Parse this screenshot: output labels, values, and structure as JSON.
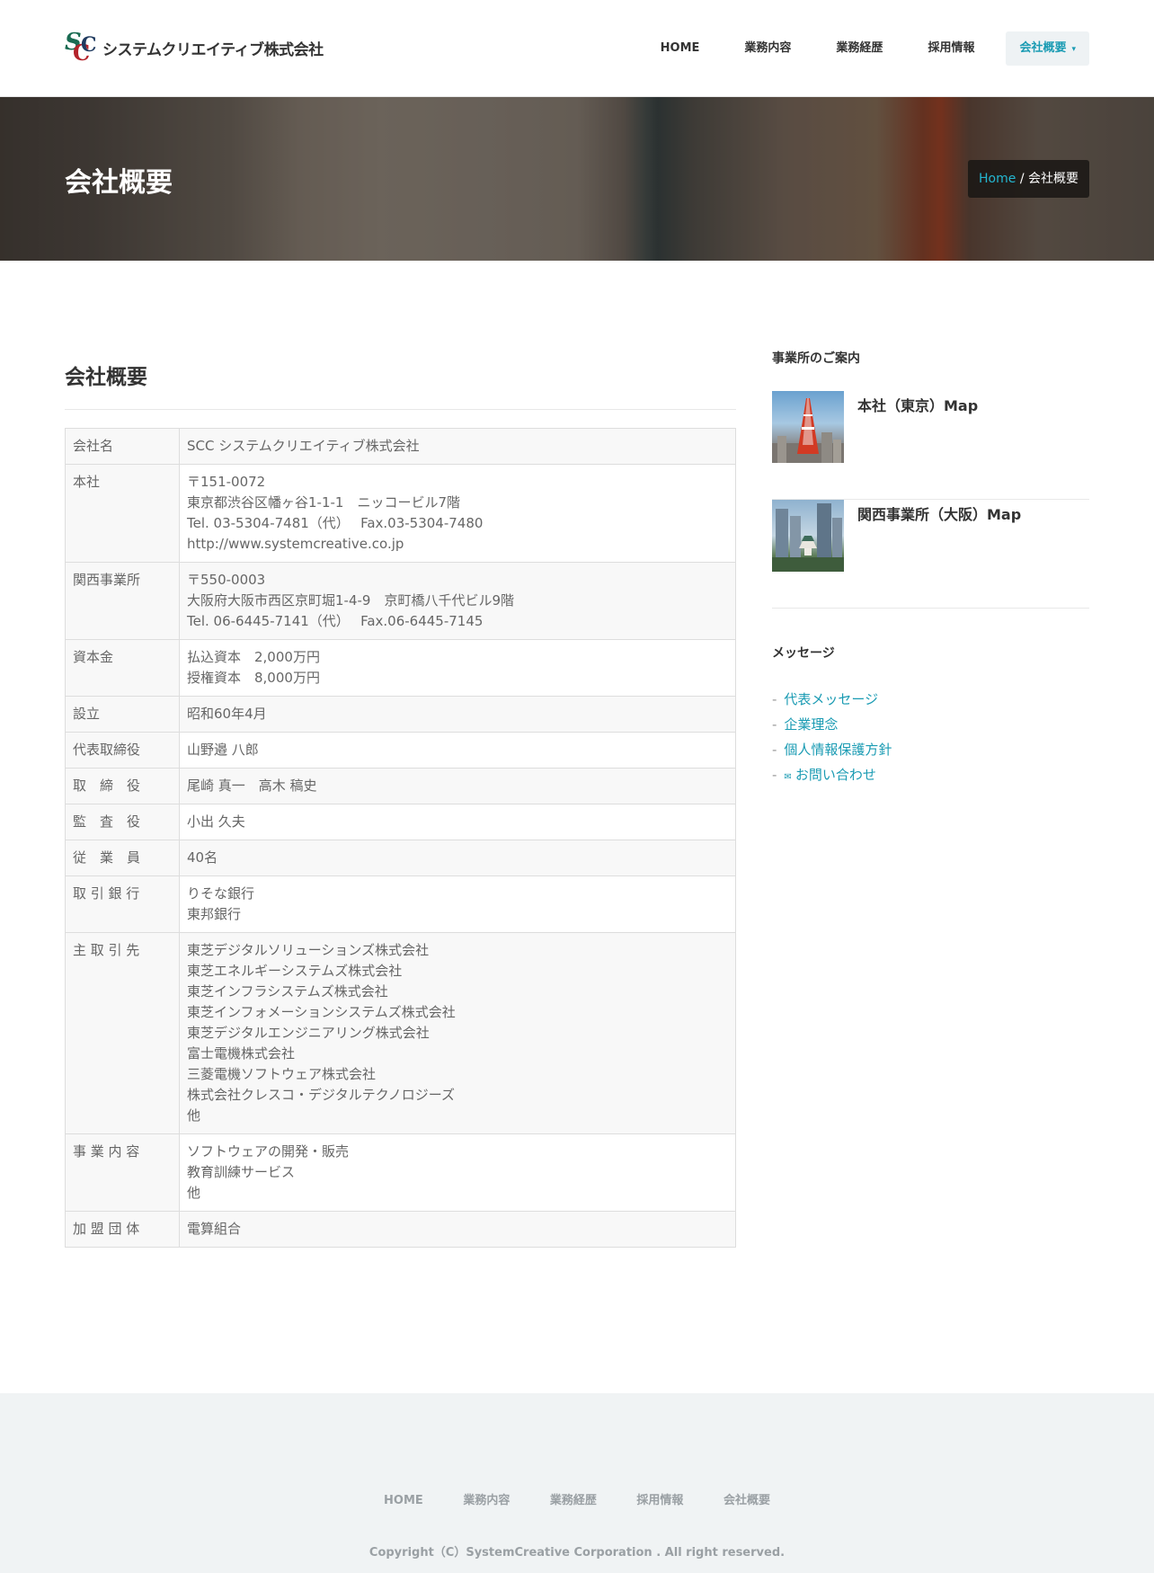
{
  "header": {
    "logo_text": "システムクリエイティブ株式会社",
    "nav": [
      "HOME",
      "業務内容",
      "業務経歴",
      "採用情報"
    ],
    "active_nav": "会社概要"
  },
  "hero": {
    "title": "会社概要",
    "breadcrumb_home": "Home",
    "breadcrumb_sep": " / ",
    "breadcrumb_current": "会社概要"
  },
  "main": {
    "title": "会社概要",
    "rows": [
      {
        "key": "会社名",
        "lines": [
          "SCC システムクリエイティブ株式会社"
        ]
      },
      {
        "key": "本社",
        "lines": [
          "〒151-0072",
          "東京都渋谷区幡ヶ谷1-1-1　ニッコービル7階",
          "Tel. 03-5304-7481（代）　 Fax.03-5304-7480",
          "http://www.systemcreative.co.jp"
        ]
      },
      {
        "key": "関西事業所",
        "lines": [
          "〒550-0003",
          "大阪府大阪市西区京町堀1-4-9　京町橋八千代ビル9階",
          "Tel. 06-6445-7141（代）　 Fax.06-6445-7145"
        ]
      },
      {
        "key": "資本金",
        "lines": [
          "払込資本　2,000万円",
          "授権資本　8,000万円"
        ]
      },
      {
        "key": "設立",
        "lines": [
          "昭和60年4月"
        ]
      },
      {
        "key": "代表取締役",
        "lines": [
          "山野邉 八郎"
        ]
      },
      {
        "key": "取　締　役",
        "lines": [
          "尾崎 真一　高木 稿史"
        ]
      },
      {
        "key": "監　査　役",
        "lines": [
          "小出 久夫"
        ]
      },
      {
        "key": "従　業　員",
        "lines": [
          "40名"
        ]
      },
      {
        "key": "取 引 銀 行",
        "lines": [
          "りそな銀行",
          "東邦銀行"
        ]
      },
      {
        "key": "主 取 引 先",
        "lines": [
          "東芝デジタルソリューションズ株式会社",
          "東芝エネルギーシステムズ株式会社",
          "東芝インフラシステムズ株式会社",
          "東芝インフォメーションシステムズ株式会社",
          "東芝デジタルエンジニアリング株式会社",
          "富士電機株式会社",
          "三菱電機ソフトウェア株式会社",
          "株式会社クレスコ・デジタルテクノロジーズ",
          "他"
        ]
      },
      {
        "key": "事 業 内 容",
        "lines": [
          "ソフトウェアの開発・販売",
          "教育訓練サービス",
          "他"
        ]
      },
      {
        "key": "加 盟 団 体",
        "lines": [
          "電算組合"
        ]
      }
    ]
  },
  "sidebar": {
    "offices_heading": "事業所のご案内",
    "offices": [
      {
        "label": "本社（東京）Map",
        "icon": "tokyo-tower-photo"
      },
      {
        "label": "関西事業所（大阪）Map",
        "icon": "osaka-castle-photo"
      }
    ],
    "message_heading": "メッセージ",
    "links": [
      "代表メッセージ",
      "企業理念",
      "個人情報保護方針"
    ],
    "contact_link": "お問い合わせ"
  },
  "footer": {
    "nav": [
      "HOME",
      "業務内容",
      "業務経歴",
      "採用情報",
      "会社概要"
    ],
    "copyright": "Copyright（C）SystemCreative Corporation . All right reserved."
  },
  "colors": {
    "accent": "#1a9bb3",
    "footer_bg": "#f0f3f4",
    "text": "#555555"
  }
}
